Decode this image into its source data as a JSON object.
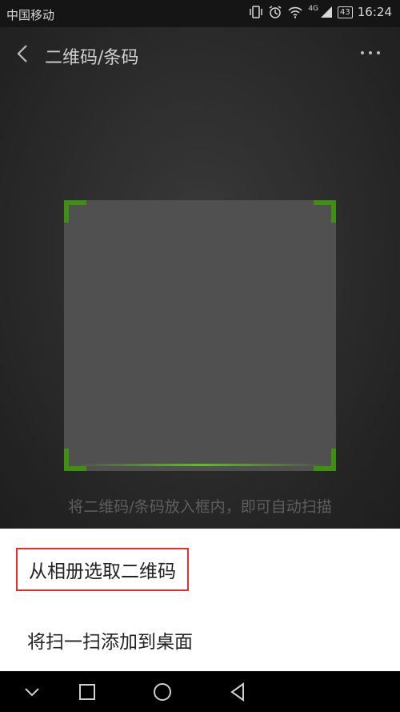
{
  "status_bar": {
    "carrier": "中国移动",
    "network": "4G",
    "battery": "43",
    "time": "16:24",
    "icons": [
      "vibrate-icon",
      "alarm-icon",
      "wifi-icon",
      "signal-icon",
      "battery-icon"
    ]
  },
  "header": {
    "title": "二维码/条码",
    "back_icon": "chevron-left-icon",
    "more_icon": "more-dots-icon"
  },
  "scanner": {
    "hint": "将二维码/条码放入框内，即可自动扫描",
    "accent_color": "#3e8f12"
  },
  "sheet": {
    "options": [
      {
        "label": "从相册选取二维码",
        "highlighted": true
      },
      {
        "label": "将扫一扫添加到桌面",
        "highlighted": false
      }
    ],
    "highlight_color": "#e0332b"
  },
  "nav_bar": {
    "buttons": [
      "chevron-down-icon",
      "square-icon",
      "circle-icon",
      "triangle-back-icon"
    ]
  }
}
